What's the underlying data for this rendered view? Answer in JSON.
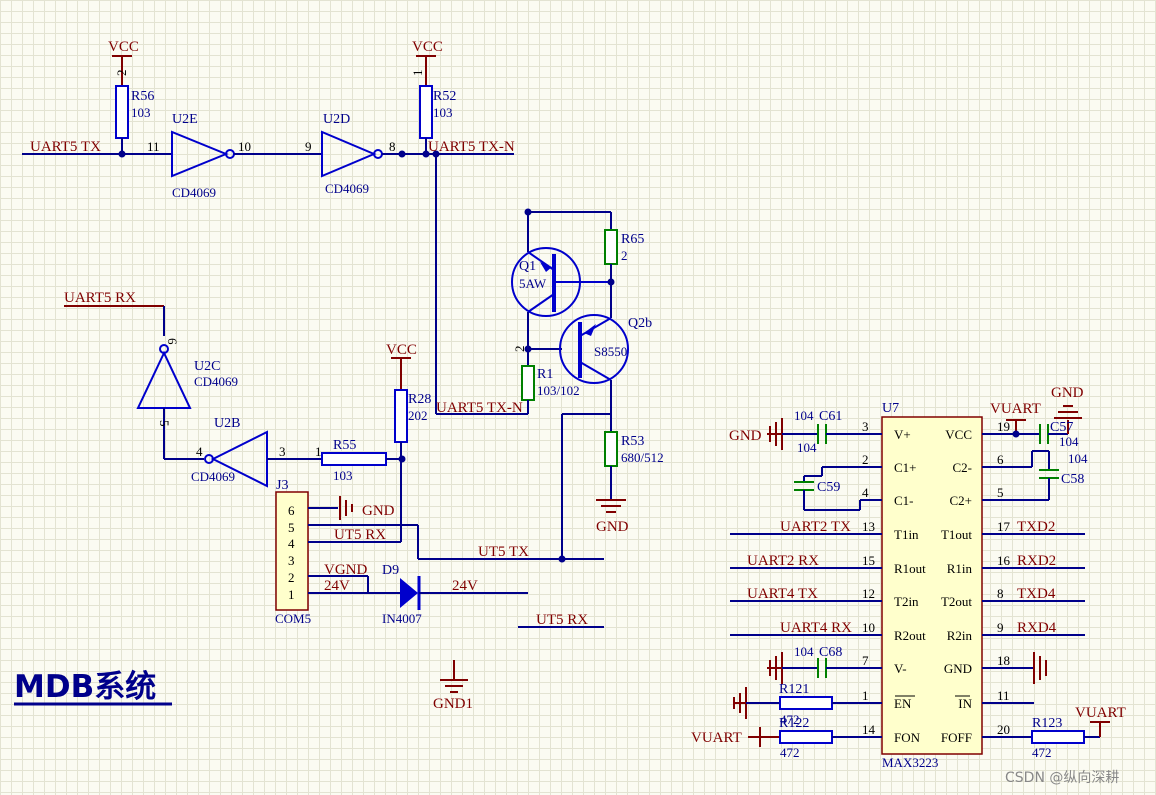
{
  "title": "MDB系统",
  "watermark": "CSDN @纵向深耕",
  "nets": {
    "vcc": "VCC",
    "gnd": "GND",
    "gnd1": "GND1",
    "vgnd": "VGND",
    "vuart": "VUART",
    "v24": "24V",
    "uart5_tx": "UART5 TX",
    "uart5_rx": "UART5 RX",
    "uart5_txn": "UART5 TX-N",
    "ut5_rx": "UT5 RX",
    "ut5_tx": "UT5 TX",
    "uart2_tx": "UART2 TX",
    "uart2_rx": "UART2 RX",
    "uart4_tx": "UART4 TX",
    "uart4_rx": "UART4 RX",
    "txd2": "TXD2",
    "rxd2": "RXD2",
    "txd4": "TXD4",
    "rxd4": "RXD4"
  },
  "components": {
    "r56": {
      "name": "R56",
      "value": "103"
    },
    "r52": {
      "name": "R52",
      "value": "103"
    },
    "r65": {
      "name": "R65",
      "value": "2"
    },
    "r1": {
      "name": "R1",
      "value": "103/102"
    },
    "r28": {
      "name": "R28",
      "value": "202"
    },
    "r55": {
      "name": "R55",
      "value": "103"
    },
    "r53": {
      "name": "R53",
      "value": "680/512"
    },
    "r121": {
      "name": "R121",
      "value": "472"
    },
    "r122": {
      "name": "R122",
      "value": "472"
    },
    "r123": {
      "name": "R123",
      "value": "472"
    },
    "u2e": {
      "name": "U2E",
      "part": "CD4069"
    },
    "u2d": {
      "name": "U2D",
      "part": "CD4069"
    },
    "u2c": {
      "name": "U2C",
      "part": "CD4069"
    },
    "u2b": {
      "name": "U2B",
      "part": "CD4069"
    },
    "q1": {
      "name": "Q1",
      "part": "5AW"
    },
    "q2": {
      "name": "Q2b",
      "part": "S8550"
    },
    "j3": {
      "name": "J3",
      "part": "COM5",
      "pins": [
        "6",
        "5",
        "4",
        "3",
        "2",
        "1"
      ]
    },
    "d9": {
      "name": "D9",
      "part": "IN4007"
    },
    "c61": {
      "name": "C61",
      "value": "104"
    },
    "c59": {
      "name": "C59",
      "value": "104"
    },
    "c57": {
      "name": "C57",
      "value": "104"
    },
    "c58": {
      "name": "C58",
      "value": "104"
    },
    "c68": {
      "name": "C68",
      "value": "104"
    },
    "u7": {
      "name": "U7",
      "part": "MAX3223"
    }
  },
  "u7_left_pins": [
    {
      "num": "3",
      "name": "V+"
    },
    {
      "num": "2",
      "name": "C1+"
    },
    {
      "num": "4",
      "name": "C1-"
    },
    {
      "num": "13",
      "name": "T1in"
    },
    {
      "num": "15",
      "name": "R1out"
    },
    {
      "num": "12",
      "name": "T2in"
    },
    {
      "num": "10",
      "name": "R2out"
    },
    {
      "num": "7",
      "name": "V-"
    },
    {
      "num": "1",
      "name": "EN"
    },
    {
      "num": "14",
      "name": "FON"
    }
  ],
  "u7_right_pins": [
    {
      "num": "19",
      "name": "VCC"
    },
    {
      "num": "6",
      "name": "C2-"
    },
    {
      "num": "5",
      "name": "C2+"
    },
    {
      "num": "17",
      "name": "T1out"
    },
    {
      "num": "16",
      "name": "R1in"
    },
    {
      "num": "8",
      "name": "T2out"
    },
    {
      "num": "9",
      "name": "R2in"
    },
    {
      "num": "18",
      "name": "GND"
    },
    {
      "num": "11",
      "name": "IN"
    },
    {
      "num": "20",
      "name": "FOFF"
    }
  ],
  "pin_numbers": {
    "r56_top": "2",
    "r52_top": "1",
    "u2e_in": "11",
    "u2e_out": "10",
    "u2d_in": "9",
    "u2d_out": "8",
    "u2c_out": "6",
    "u2c_in": "5",
    "u2b_in": "3",
    "u2b_out": "4",
    "r55_end": "1",
    "r1_top": "2"
  }
}
